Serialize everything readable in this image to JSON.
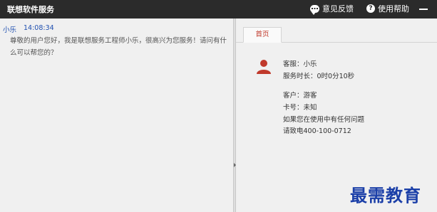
{
  "titlebar": {
    "title": "联想软件服务",
    "feedback_label": "意见反馈",
    "help_label": "使用帮助",
    "feedback_icon": "chat-bubble-icon",
    "help_icon": "help-circle-icon"
  },
  "chat": {
    "sender": "小乐",
    "time": "14:08:34",
    "message": "尊敬的用户您好，我是联想服务工程师小乐，很高兴为您服务！请问有什么可以帮您的？"
  },
  "info": {
    "tab_label": "首页",
    "agent": "客服：小乐",
    "duration": "服务时长：0时0分10秒",
    "customer": "客户：游客",
    "card": "卡号：未知",
    "help_line": "如果您在使用中有任何问题",
    "phone_line": "请致电400-100-0712"
  },
  "watermark": "最需教育",
  "colors": {
    "titlebar": "#2b2b2b",
    "sender": "#1f4fb0",
    "tab_text": "#c0392b",
    "avatar": "#c0392b",
    "watermark": "#1b3fa8"
  }
}
